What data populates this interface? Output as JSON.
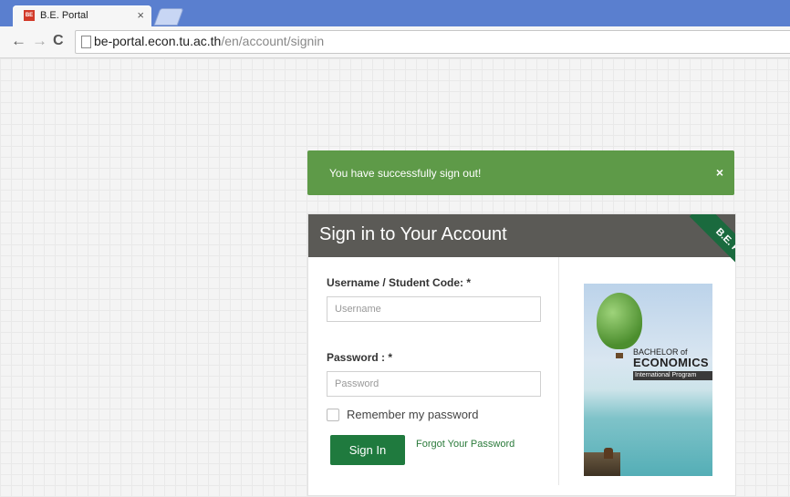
{
  "browser": {
    "tab_title": "B.E. Portal",
    "tab_close": "×",
    "favicon_text": "BE",
    "url_host": "be-portal.econ.tu.ac.th",
    "url_path": "/en/account/signin",
    "back": "←",
    "forward": "→",
    "reload": "C"
  },
  "alert": {
    "message": "You have successfully sign out!",
    "close": "×",
    "color": "#5e9a48"
  },
  "signin": {
    "title": "Sign in to Your Account",
    "ribbon": "B.E. Portal",
    "username_label": "Username / Student Code: *",
    "username_placeholder": "Username",
    "password_label": "Password : *",
    "password_placeholder": "Password",
    "remember_label": "Remember my password",
    "submit_label": "Sign In",
    "forgot_label": "Forgot Your Password",
    "accent_color": "#1f7a3e"
  },
  "cover": {
    "line1": "BACHELOR of",
    "line2": "ECONOMICS",
    "line3": "International Program"
  }
}
